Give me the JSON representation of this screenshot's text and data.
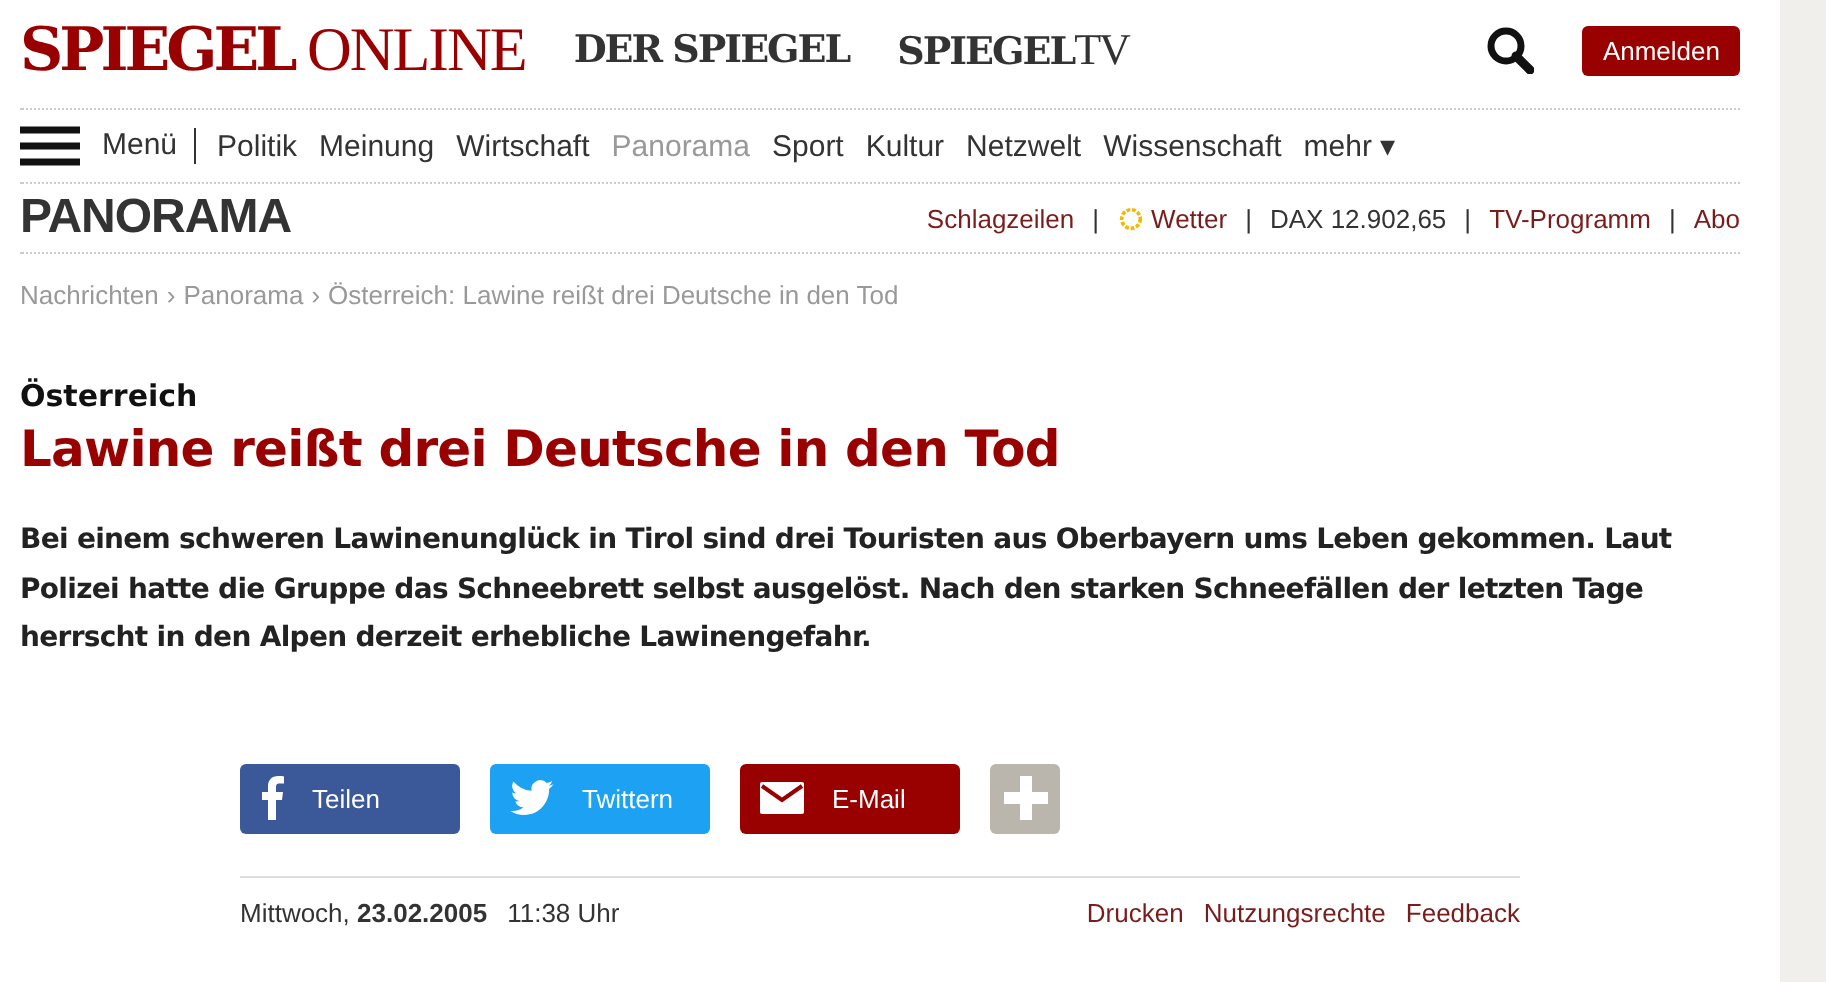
{
  "header": {
    "logo_main": "SPIEGEL",
    "logo_sub": "ONLINE",
    "brands": [
      {
        "main": "DER SPIEGEL"
      },
      {
        "main": "SPIEGEL",
        "sub": "TV"
      }
    ],
    "login": "Anmelden"
  },
  "nav": {
    "menu": "Menü",
    "items": [
      {
        "label": "Politik",
        "selected": false
      },
      {
        "label": "Meinung",
        "selected": false
      },
      {
        "label": "Wirtschaft",
        "selected": false
      },
      {
        "label": "Panorama",
        "selected": true
      },
      {
        "label": "Sport",
        "selected": false
      },
      {
        "label": "Kultur",
        "selected": false
      },
      {
        "label": "Netzwelt",
        "selected": false
      },
      {
        "label": "Wissenschaft",
        "selected": false
      }
    ],
    "more": "mehr ▾"
  },
  "section": {
    "title": "PANORAMA",
    "separator": "|",
    "links": [
      {
        "kind": "link",
        "label": "Schlagzeilen"
      },
      {
        "kind": "weather",
        "label": "Wetter"
      },
      {
        "kind": "text",
        "label": "DAX 12.902,65"
      },
      {
        "kind": "link",
        "label": "TV-Programm"
      },
      {
        "kind": "link",
        "label": "Abo"
      }
    ]
  },
  "breadcrumb": {
    "separator": "›",
    "items": [
      "Nachrichten",
      "Panorama",
      "Österreich: Lawine reißt drei Deutsche in den Tod"
    ]
  },
  "article": {
    "kicker": "Österreich",
    "title": "Lawine reißt drei Deutsche in den Tod",
    "lead": "Bei einem schweren Lawinenunglück in Tirol sind drei Touristen aus Oberbayern ums Leben gekommen. Laut Polizei hatte die Gruppe das Schneebrett selbst ausgelöst. Nach den starken Schneefällen der letzten Tage herrscht in den Alpen derzeit erhebliche Lawinengefahr."
  },
  "share": [
    {
      "kind": "facebook",
      "label": "Teilen"
    },
    {
      "kind": "twitter",
      "label": "Twittern"
    },
    {
      "kind": "email",
      "label": "E-Mail"
    },
    {
      "kind": "more"
    }
  ],
  "footer": {
    "date": "Mittwoch, **23.02.2005**",
    "time": "11:38 Uhr",
    "links": [
      "Drucken",
      "Nutzungsrechte",
      "Feedback"
    ]
  }
}
